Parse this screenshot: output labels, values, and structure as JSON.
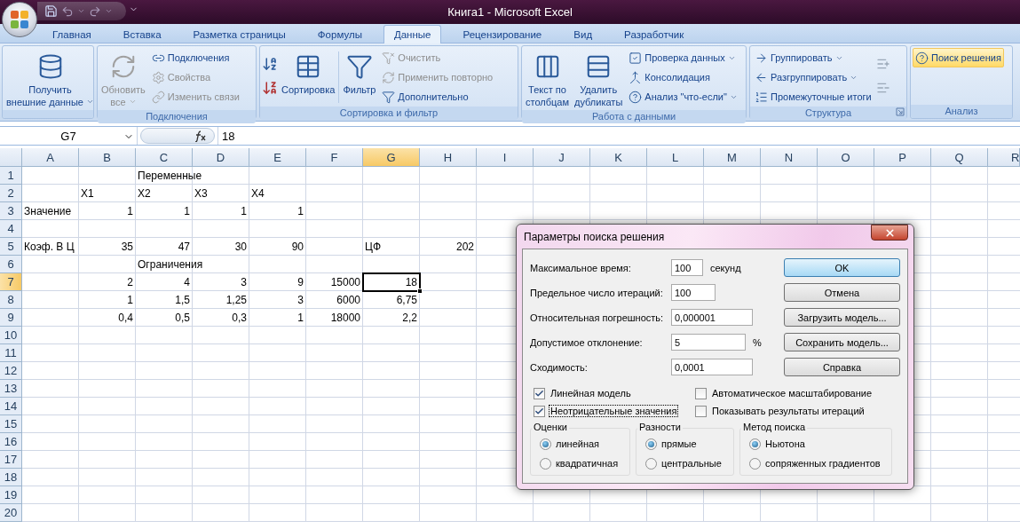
{
  "window": {
    "title": "Книга1 - Microsoft Excel"
  },
  "tabs": [
    {
      "label": "Главная",
      "selected": false
    },
    {
      "label": "Вставка",
      "selected": false
    },
    {
      "label": "Разметка страницы",
      "selected": false
    },
    {
      "label": "Формулы",
      "selected": false
    },
    {
      "label": "Данные",
      "selected": true
    },
    {
      "label": "Рецензирование",
      "selected": false
    },
    {
      "label": "Вид",
      "selected": false
    },
    {
      "label": "Разработчик",
      "selected": false
    }
  ],
  "ribbon": [
    {
      "columns": [
        {
          "kind": "large",
          "lines": [
            "Получить",
            "внешние данные"
          ],
          "disabled": false,
          "dropdown": true
        }
      ]
    },
    {
      "label": "Подключения",
      "columns": [
        {
          "kind": "large",
          "lines": [
            "Обновить",
            "все"
          ],
          "disabled": true,
          "dropdown": true
        },
        {
          "kind": "stack",
          "items": [
            {
              "label": "Подключения",
              "disabled": false,
              "dropdown": false
            },
            {
              "label": "Свойства",
              "disabled": true,
              "dropdown": false
            },
            {
              "label": "Изменить связи",
              "disabled": true,
              "dropdown": false
            }
          ]
        }
      ]
    },
    {
      "label": "Сортировка и фильтр",
      "columns": [
        {
          "kind": "sort-icons"
        },
        {
          "kind": "large",
          "lines": [
            "Сортировка"
          ],
          "disabled": false,
          "dropdown": false
        },
        {
          "kind": "separator"
        },
        {
          "kind": "large",
          "lines": [
            "Фильтр"
          ],
          "disabled": false,
          "dropdown": false
        },
        {
          "kind": "stack",
          "items": [
            {
              "label": "Очистить",
              "disabled": true,
              "dropdown": false
            },
            {
              "label": "Применить повторно",
              "disabled": true,
              "dropdown": false
            },
            {
              "label": "Дополнительно",
              "disabled": false,
              "dropdown": false
            }
          ]
        }
      ]
    },
    {
      "label": "Работа с данными",
      "columns": [
        {
          "kind": "large",
          "lines": [
            "Текст по",
            "столбцам"
          ],
          "disabled": false,
          "dropdown": false
        },
        {
          "kind": "large",
          "lines": [
            "Удалить",
            "дубликаты"
          ],
          "disabled": false,
          "dropdown": false
        },
        {
          "kind": "stack",
          "items": [
            {
              "label": "Проверка данных",
              "disabled": false,
              "dropdown": true
            },
            {
              "label": "Консолидация",
              "disabled": false,
              "dropdown": false
            },
            {
              "label": "Анализ \"что-если\"",
              "disabled": false,
              "dropdown": true
            }
          ]
        }
      ]
    },
    {
      "label": "Структура",
      "launcher": true,
      "columns": [
        {
          "kind": "stack",
          "items": [
            {
              "label": "Группировать",
              "disabled": false,
              "dropdown": true
            },
            {
              "label": "Разгруппировать",
              "disabled": false,
              "dropdown": true
            },
            {
              "label": "Промежуточные итоги",
              "disabled": false,
              "dropdown": false
            }
          ]
        },
        {
          "kind": "outline-icons"
        }
      ]
    },
    {
      "label": "Анализ",
      "columns": [
        {
          "kind": "stack",
          "items": [
            {
              "label": "Поиск решения",
              "disabled": false,
              "dropdown": false,
              "highlighted": true
            }
          ]
        }
      ]
    }
  ],
  "formula_bar": {
    "name_box": "G7",
    "value": "18"
  },
  "sheet": {
    "columns": [
      {
        "label": "A",
        "selected": false
      },
      {
        "label": "B",
        "selected": false
      },
      {
        "label": "C",
        "selected": false
      },
      {
        "label": "D",
        "selected": false
      },
      {
        "label": "E",
        "selected": false
      },
      {
        "label": "F",
        "selected": false
      },
      {
        "label": "G",
        "selected": true
      },
      {
        "label": "H",
        "selected": false
      },
      {
        "label": "I",
        "selected": false
      },
      {
        "label": "J",
        "selected": false
      },
      {
        "label": "K",
        "selected": false
      },
      {
        "label": "L",
        "selected": false
      },
      {
        "label": "M",
        "selected": false
      },
      {
        "label": "N",
        "selected": false
      },
      {
        "label": "O",
        "selected": false
      },
      {
        "label": "P",
        "selected": false
      },
      {
        "label": "Q",
        "selected": false
      },
      {
        "label": "R",
        "selected": false
      }
    ],
    "rows": [
      {
        "label": "1",
        "selected": false,
        "cells": {
          "C": {
            "text": "Переменные",
            "kind": "text",
            "selected": false
          }
        }
      },
      {
        "label": "2",
        "selected": false,
        "cells": {
          "B": {
            "text": "X1",
            "kind": "text",
            "selected": false
          },
          "C": {
            "text": "X2",
            "kind": "text",
            "selected": false
          },
          "D": {
            "text": "X3",
            "kind": "text",
            "selected": false
          },
          "E": {
            "text": "X4",
            "kind": "text",
            "selected": false
          }
        }
      },
      {
        "label": "3",
        "selected": false,
        "cells": {
          "A": {
            "text": "Значение",
            "kind": "text",
            "selected": false
          },
          "B": {
            "text": "1",
            "kind": "number",
            "selected": false
          },
          "C": {
            "text": "1",
            "kind": "number",
            "selected": false
          },
          "D": {
            "text": "1",
            "kind": "number",
            "selected": false
          },
          "E": {
            "text": "1",
            "kind": "number",
            "selected": false
          }
        }
      },
      {
        "label": "4",
        "selected": false,
        "cells": {}
      },
      {
        "label": "5",
        "selected": false,
        "cells": {
          "A": {
            "text": "Коэф. В Ц",
            "kind": "text",
            "selected": false
          },
          "B": {
            "text": "35",
            "kind": "number",
            "selected": false
          },
          "C": {
            "text": "47",
            "kind": "number",
            "selected": false
          },
          "D": {
            "text": "30",
            "kind": "number",
            "selected": false
          },
          "E": {
            "text": "90",
            "kind": "number",
            "selected": false
          },
          "G": {
            "text": "ЦФ",
            "kind": "text",
            "selected": false
          },
          "H": {
            "text": "202",
            "kind": "number",
            "selected": false
          }
        }
      },
      {
        "label": "6",
        "selected": false,
        "cells": {
          "C": {
            "text": "Ограничения",
            "kind": "text",
            "selected": false
          }
        }
      },
      {
        "label": "7",
        "selected": true,
        "cells": {
          "B": {
            "text": "2",
            "kind": "number",
            "selected": false
          },
          "C": {
            "text": "4",
            "kind": "number",
            "selected": false
          },
          "D": {
            "text": "3",
            "kind": "number",
            "selected": false
          },
          "E": {
            "text": "9",
            "kind": "number",
            "selected": false
          },
          "F": {
            "text": "15000",
            "kind": "number",
            "selected": false
          },
          "G": {
            "text": "18",
            "kind": "number",
            "selected": true
          }
        }
      },
      {
        "label": "8",
        "selected": false,
        "cells": {
          "B": {
            "text": "1",
            "kind": "number",
            "selected": false
          },
          "C": {
            "text": "1,5",
            "kind": "number",
            "selected": false
          },
          "D": {
            "text": "1,25",
            "kind": "number",
            "selected": false
          },
          "E": {
            "text": "3",
            "kind": "number",
            "selected": false
          },
          "F": {
            "text": "6000",
            "kind": "number",
            "selected": false
          },
          "G": {
            "text": "6,75",
            "kind": "number",
            "selected": false
          }
        }
      },
      {
        "label": "9",
        "selected": false,
        "cells": {
          "B": {
            "text": "0,4",
            "kind": "number",
            "selected": false
          },
          "C": {
            "text": "0,5",
            "kind": "number",
            "selected": false
          },
          "D": {
            "text": "0,3",
            "kind": "number",
            "selected": false
          },
          "E": {
            "text": "1",
            "kind": "number",
            "selected": false
          },
          "F": {
            "text": "18000",
            "kind": "number",
            "selected": false
          },
          "G": {
            "text": "2,2",
            "kind": "number",
            "selected": false
          }
        }
      },
      {
        "label": "10",
        "selected": false,
        "cells": {}
      },
      {
        "label": "11",
        "selected": false,
        "cells": {}
      },
      {
        "label": "12",
        "selected": false,
        "cells": {}
      },
      {
        "label": "13",
        "selected": false,
        "cells": {}
      },
      {
        "label": "14",
        "selected": false,
        "cells": {}
      },
      {
        "label": "15",
        "selected": false,
        "cells": {}
      },
      {
        "label": "16",
        "selected": false,
        "cells": {}
      },
      {
        "label": "17",
        "selected": false,
        "cells": {}
      },
      {
        "label": "18",
        "selected": false,
        "cells": {}
      },
      {
        "label": "19",
        "selected": false,
        "cells": {}
      },
      {
        "label": "20",
        "selected": false,
        "cells": {}
      }
    ]
  },
  "dialog": {
    "title": "Параметры поиска решения",
    "fields": [
      {
        "label": "Максимальное время:",
        "value": "100",
        "unit": "секунд"
      },
      {
        "label": "Предельное число итераций:",
        "value": "100"
      },
      {
        "label": "Относительная погрешность:",
        "value": "0,000001"
      },
      {
        "label": "Допустимое отклонение:",
        "value": "5",
        "unit": "%"
      },
      {
        "label": "Сходимость:",
        "value": "0,0001"
      }
    ],
    "buttons": [
      {
        "label": "OK",
        "default": true
      },
      {
        "label": "Отмена",
        "default": false
      },
      {
        "label": "Загрузить модель...",
        "default": false
      },
      {
        "label": "Сохранить модель...",
        "default": false
      },
      {
        "label": "Справка",
        "default": false
      }
    ],
    "checkboxes": [
      {
        "label": "Линейная модель",
        "checked": true,
        "focused": false
      },
      {
        "label": "Автоматическое масштабирование",
        "checked": false,
        "focused": false
      },
      {
        "label": "Неотрицательные значения",
        "checked": true,
        "focused": true
      },
      {
        "label": "Показывать результаты итераций",
        "checked": false,
        "focused": false
      }
    ],
    "groups": [
      {
        "title": "Оценки",
        "options": [
          {
            "label": "линейная",
            "selected": true
          },
          {
            "label": "квадратичная",
            "selected": false
          }
        ]
      },
      {
        "title": "Разности",
        "options": [
          {
            "label": "прямые",
            "selected": true
          },
          {
            "label": "центральные",
            "selected": false
          }
        ]
      },
      {
        "title": "Метод поиска",
        "options": [
          {
            "label": "Ньютона",
            "selected": true
          },
          {
            "label": "сопряженных градиентов",
            "selected": false
          }
        ]
      }
    ]
  }
}
